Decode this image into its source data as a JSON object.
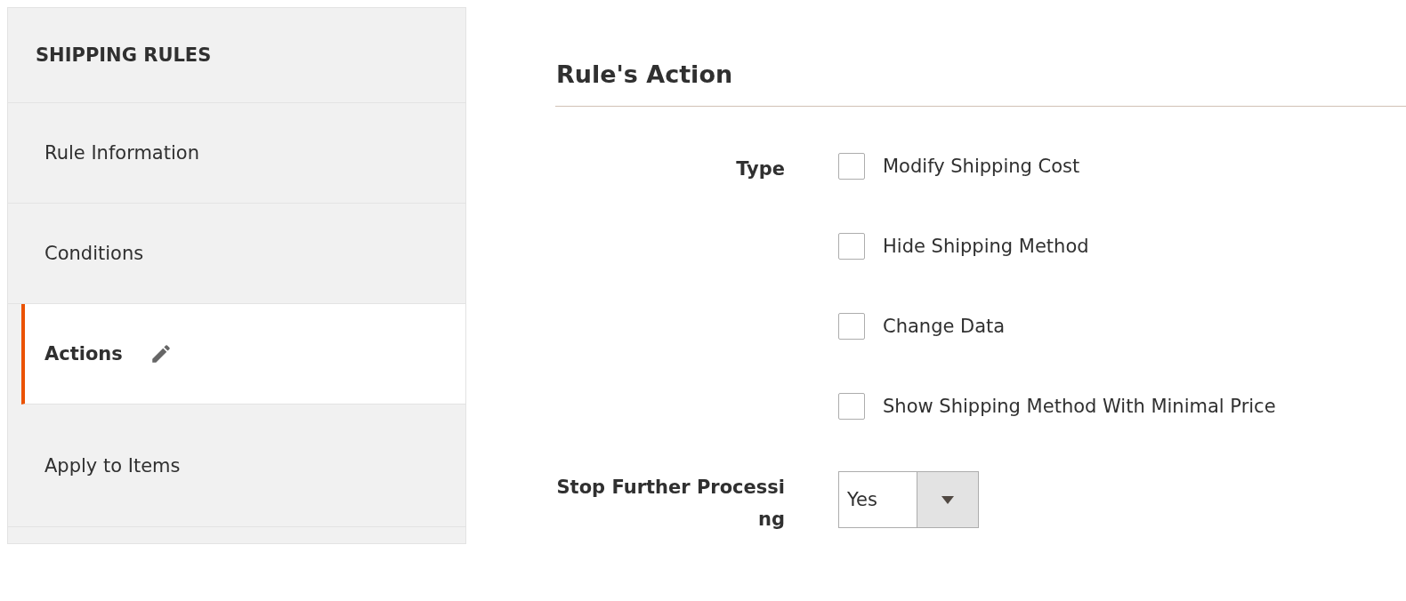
{
  "sidebar": {
    "title": "SHIPPING RULES",
    "items": [
      {
        "label": "Rule Information",
        "selected": false,
        "changed": false
      },
      {
        "label": "Conditions",
        "selected": false,
        "changed": false
      },
      {
        "label": "Actions",
        "selected": true,
        "changed": true
      },
      {
        "label": "Apply to Items",
        "selected": false,
        "changed": false
      }
    ]
  },
  "section": {
    "title": "Rule's Action",
    "fields": [
      {
        "kind": "checkboxes",
        "label": "Type",
        "options": [
          {
            "label": "Modify Shipping Cost",
            "checked": false
          },
          {
            "label": "Hide Shipping Method",
            "checked": false
          },
          {
            "label": "Change Data",
            "checked": false
          },
          {
            "label": "Show Shipping Method With Minimal Price",
            "checked": false
          }
        ]
      },
      {
        "kind": "select",
        "label": "Stop Further Processing",
        "value": "Yes"
      }
    ]
  }
}
